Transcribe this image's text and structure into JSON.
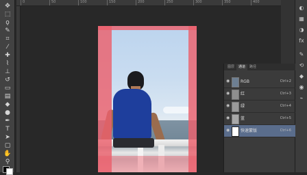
{
  "ruler": {
    "ticks": [
      "0",
      "50",
      "100",
      "150",
      "200",
      "250",
      "300",
      "350",
      "400"
    ]
  },
  "toolbar": {
    "tools": [
      "move-tool",
      "marquee-tool",
      "lasso-tool",
      "quick-select-tool",
      "crop-tool",
      "eyedropper-tool",
      "healing-brush-tool",
      "brush-tool",
      "clone-stamp-tool",
      "history-brush-tool",
      "eraser-tool",
      "gradient-tool",
      "blur-tool",
      "dodge-tool",
      "pen-tool",
      "type-tool",
      "path-select-tool",
      "shape-tool",
      "hand-tool",
      "zoom-tool"
    ],
    "colors": {
      "foreground": "#000000",
      "background": "#ffffff"
    }
  },
  "panel": {
    "tabs": [
      "图层",
      "通道",
      "路径"
    ],
    "active_tab": "通道",
    "channels": [
      {
        "name": "RGB",
        "shortcut": "Ctrl+2",
        "selected": false
      },
      {
        "name": "红",
        "shortcut": "Ctrl+3",
        "selected": false
      },
      {
        "name": "绿",
        "shortcut": "Ctrl+4",
        "selected": false
      },
      {
        "name": "蓝",
        "shortcut": "Ctrl+5",
        "selected": false
      },
      {
        "name": "快速蒙版",
        "shortcut": "Ctrl+6",
        "selected": true
      }
    ]
  },
  "dock": {
    "icons": [
      "color-icon",
      "swatches-icon",
      "adjustments-icon",
      "styles-icon",
      "brush-presets-icon",
      "history-icon",
      "properties-icon",
      "layers-icon",
      "channels-icon",
      "paths-icon"
    ]
  },
  "mask": {
    "overlay_color": "#ec606c"
  }
}
